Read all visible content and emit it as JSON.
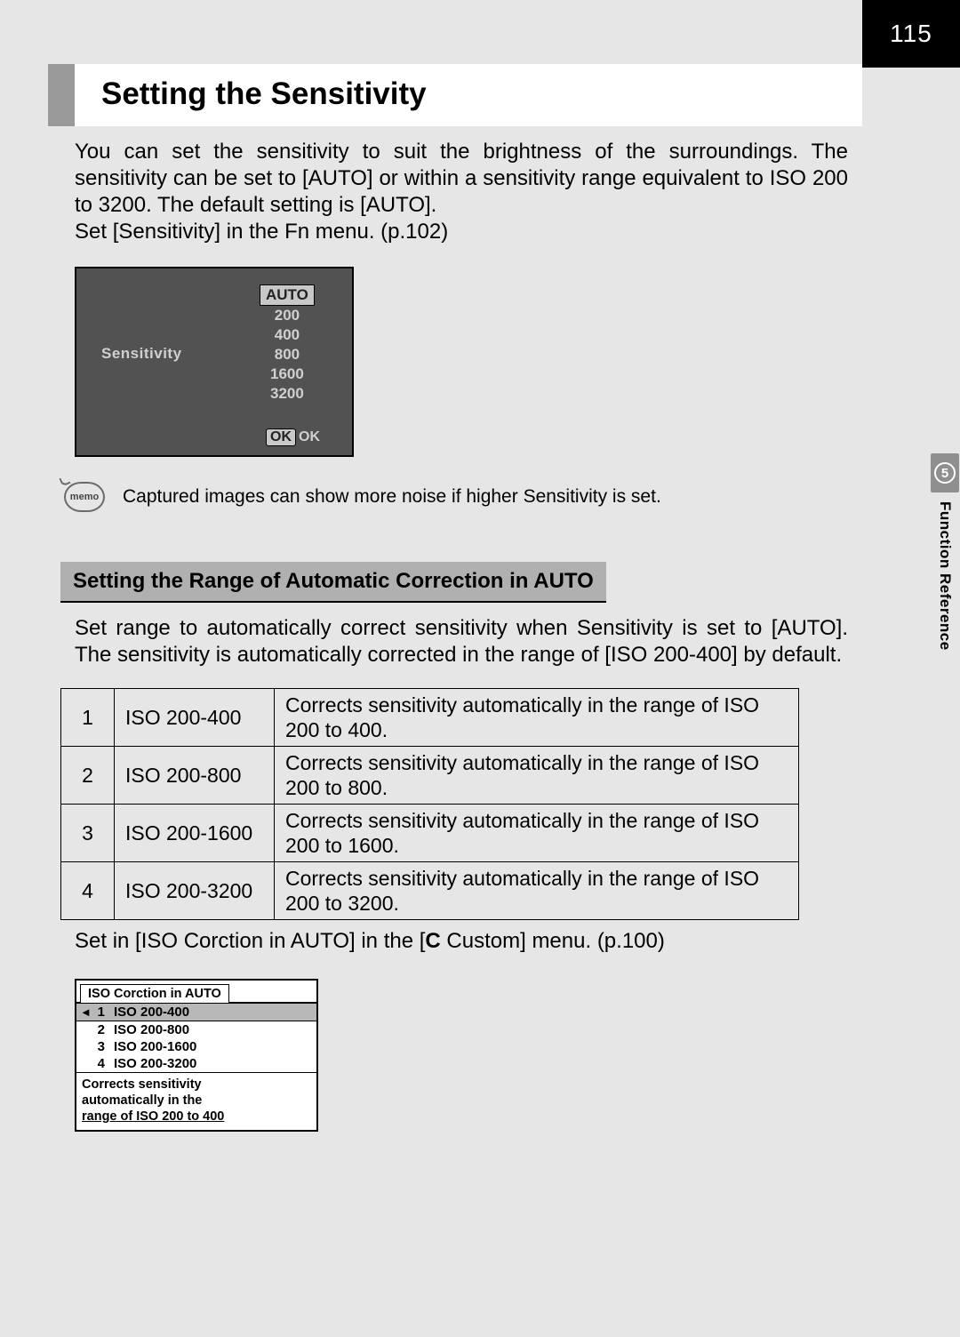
{
  "page_number": "115",
  "chapter": {
    "number": "5",
    "title": "Function Reference"
  },
  "heading": "Setting the Sensitivity",
  "intro": "You can set the sensitivity to suit the brightness of the surroundings. The sensitivity can be set to [AUTO] or within a sensitivity range equivalent to ISO 200 to 3200. The default setting is [AUTO].\nSet [Sensitivity] in the Fn menu. (p.102)",
  "lcd_sensitivity": {
    "label": "Sensitivity",
    "options": [
      "AUTO",
      "200",
      "400",
      "800",
      "1600",
      "3200"
    ],
    "selected_index": 0,
    "ok_btn": "OK",
    "ok_text": "OK"
  },
  "memo": {
    "icon_label": "memo",
    "text": "Captured images can show more noise if higher Sensitivity is set."
  },
  "subheading": "Setting the Range of Automatic Correction in AUTO",
  "sub_intro": "Set range to automatically correct sensitivity when Sensitivity is set to [AUTO]. The sensitivity is automatically corrected in the range of [ISO 200-400] by default.",
  "iso_table": [
    {
      "n": "1",
      "range": "ISO 200-400",
      "desc": "Corrects sensitivity automatically in the range of ISO 200 to 400."
    },
    {
      "n": "2",
      "range": "ISO 200-800",
      "desc": "Corrects sensitivity automatically in the range of ISO 200 to 800."
    },
    {
      "n": "3",
      "range": "ISO 200-1600",
      "desc": "Corrects sensitivity automatically in the range of ISO 200 to 1600."
    },
    {
      "n": "4",
      "range": "ISO 200-3200",
      "desc": "Corrects sensitivity automatically in the range of ISO 200 to 3200."
    }
  ],
  "foot_prefix": "Set in [ISO Corction in AUTO] in the [",
  "foot_bold": "C",
  "foot_suffix": " Custom] menu. (p.100)",
  "lcd_iso": {
    "tab": "ISO Corction in AUTO",
    "items": [
      {
        "n": "1",
        "label": "ISO 200-400"
      },
      {
        "n": "2",
        "label": "ISO 200-800"
      },
      {
        "n": "3",
        "label": "ISO 200-1600"
      },
      {
        "n": "4",
        "label": "ISO 200-3200"
      }
    ],
    "selected_index": 0,
    "desc_line1": "Corrects sensitivity",
    "desc_line2": "automatically in the",
    "desc_line3": "range of ISO 200 to 400"
  }
}
